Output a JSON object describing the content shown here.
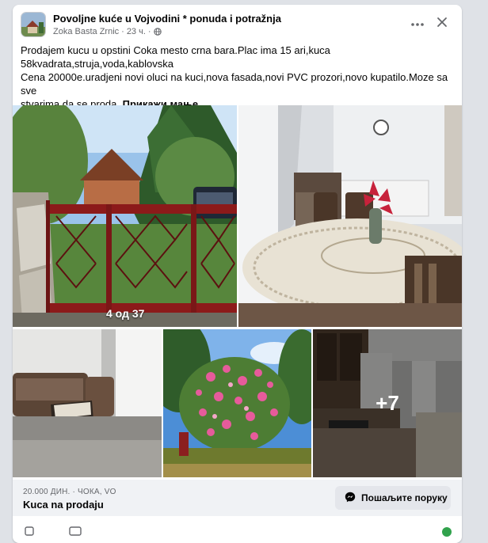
{
  "post": {
    "group_name": "Povoljne kuće u Vojvodini * ponuda i potražnja",
    "author": "Zoka Basta Zrnic",
    "separator": "·",
    "time": "23 ч.",
    "text_line1": "Prodajem kucu u opstini Coka mesto crna bara.Plac ima 15 ari,kuca",
    "text_line2": "58kvadrata,struja,voda,kablovska",
    "text_line3": "Cena 20000e.uradjeni novi oluci na kuci,nova fasada,novi PVC prozori,novo kupatilo.Moze sa sve",
    "text_line4": "stvarima da se proda.",
    "see_less": "Прикажи мање"
  },
  "icons": {
    "more": "more-horizontal-icon",
    "close": "close-icon",
    "privacy": "globe-icon",
    "messenger": "messenger-icon"
  },
  "gallery": {
    "counter": "4 од 37",
    "more_count": "+7"
  },
  "listing": {
    "price_location": "20.000 ДИН. · ЧОКА, VO",
    "title": "Kuca na prodaju",
    "message_button": "Пошаљите поруку"
  },
  "colors": {
    "card_bg": "#ffffff",
    "page_bg": "#dfe2e7",
    "listing_bg": "#f0f2f5",
    "button_bg": "#e4e6eb",
    "secondary_text": "#65676b",
    "messenger_blue": "#0866ff",
    "gate_red": "#8c1a1a"
  }
}
